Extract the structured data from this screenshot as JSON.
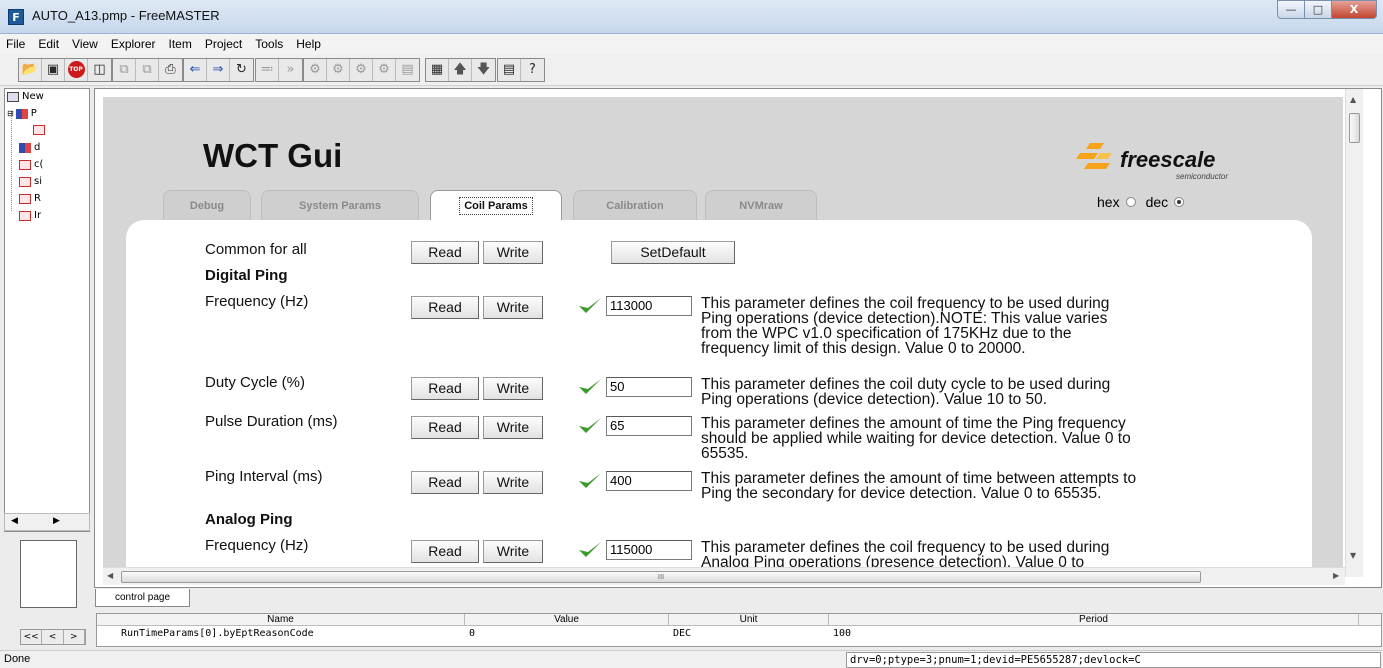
{
  "window": {
    "title": "AUTO_A13.pmp - FreeMASTER",
    "app_icon": "F",
    "minimize": "—",
    "maximize": "□",
    "close": "X"
  },
  "menu": [
    "File",
    "Edit",
    "View",
    "Explorer",
    "Item",
    "Project",
    "Tools",
    "Help"
  ],
  "tree": {
    "items": [
      {
        "label": "New",
        "icon": "new-icon"
      },
      {
        "label": "P",
        "icon": "project-icon"
      },
      {
        "label": "",
        "icon": "scope-icon"
      },
      {
        "label": "d",
        "icon": "project-icon"
      },
      {
        "label": "c(",
        "icon": "scope-icon"
      },
      {
        "label": "si",
        "icon": "scope-icon"
      },
      {
        "label": "R",
        "icon": "scope-icon"
      },
      {
        "label": "Ir",
        "icon": "scope-icon"
      }
    ],
    "mini_scroll": [
      "<<",
      "<",
      ">"
    ]
  },
  "gui": {
    "title": "WCT Gui",
    "logo_text": "freescale",
    "logo_sub": "semiconductor",
    "radio_hex": "hex",
    "radio_dec": "dec",
    "selected_radix": "dec",
    "tabs": [
      "Debug",
      "System Params",
      "Coil Params",
      "Calibration",
      "NVMraw"
    ],
    "active_tab": "Coil Params",
    "common": {
      "label": "Common for all",
      "read": "Read",
      "write": "Write",
      "setdefault": "SetDefault"
    },
    "sections": {
      "digital": "Digital Ping",
      "analog": "Analog Ping"
    },
    "rows": [
      {
        "label": "Frequency (Hz)",
        "read": "Read",
        "write": "Write",
        "value": "113000",
        "desc": [
          "This parameter defines the coil frequency to be used during",
          "Ping operations (device detection).NOTE: This value varies",
          "from the WPC v1.0 specification of 175KHz due to the",
          "frequency limit of this design. Value 0 to 20000."
        ]
      },
      {
        "label": "Duty Cycle (%)",
        "read": "Read",
        "write": "Write",
        "value": "50",
        "desc": [
          "This parameter defines the coil duty cycle to be used during",
          "Ping operations (device detection). Value 10 to 50."
        ]
      },
      {
        "label": "Pulse Duration (ms)",
        "read": "Read",
        "write": "Write",
        "value": "65",
        "desc": [
          "This parameter defines the amount of time the Ping frequency",
          "should be applied while waiting for device detection. Value 0 to",
          "65535."
        ]
      },
      {
        "label": "Ping Interval (ms)",
        "read": "Read",
        "write": "Write",
        "value": "400",
        "desc": [
          "This parameter defines the amount of time between attempts to",
          "Ping the secondary for device detection. Value 0 to 65535."
        ]
      },
      {
        "label": "Frequency (Hz)",
        "read": "Read",
        "write": "Write",
        "value": "115000",
        "desc": [
          "This parameter defines the coil frequency to be used during",
          "Analog Ping operations (presence detection). Value 0 to"
        ]
      }
    ],
    "hscroll_grip": "III"
  },
  "page_tab": "control page",
  "watch": {
    "headers": [
      "Name",
      "Value",
      "Unit",
      "Period"
    ],
    "row": [
      "RunTimeParams[0].byEptReasonCode",
      "0",
      "DEC",
      "100"
    ]
  },
  "status": {
    "left": "Done",
    "right": "drv=0;ptype=3;pnum=1;devid=PE5655287;devlock=C"
  }
}
